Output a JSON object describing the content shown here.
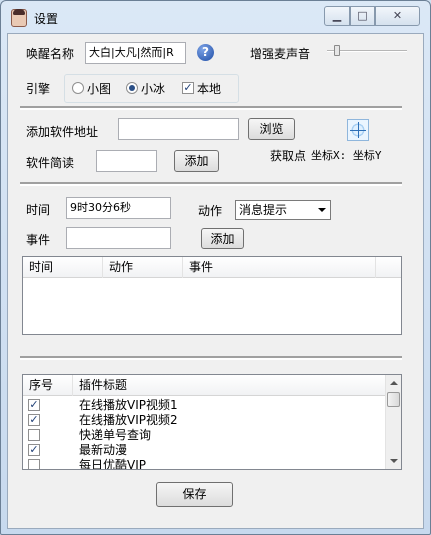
{
  "window": {
    "title": "设置",
    "icons": {
      "app": "avatar-icon",
      "min": "minimize-icon",
      "max": "maximize-icon",
      "close": "close-icon"
    }
  },
  "wake": {
    "label": "唤醒名称",
    "value": "大白|大凡|然而|R",
    "help_icon": "help-icon",
    "volume_label": "增强麦声音",
    "volume_level": 0.1
  },
  "engine": {
    "label": "引擎",
    "options": [
      {
        "label": "小图",
        "checked": false
      },
      {
        "label": "小冰",
        "checked": true
      }
    ],
    "local_label": "本地",
    "local_checked": true
  },
  "software": {
    "add_path_label": "添加软件地址",
    "path_value": "",
    "browse_label": "浏览",
    "read_label": "软件简读",
    "read_value": "",
    "add_label": "添加",
    "pick_icon": "crosshair-icon",
    "pick_label": "获取点",
    "coord_text": "坐标X: 坐标Y"
  },
  "schedule": {
    "time_label": "时间",
    "time_value": "9时30分6秒",
    "action_label": "动作",
    "action_value": "消息提示",
    "event_label": "事件",
    "event_value": "",
    "add_label": "添加",
    "columns": [
      "时间",
      "动作",
      "事件"
    ]
  },
  "plugins": {
    "columns": [
      "序号",
      "插件标题"
    ],
    "rows": [
      {
        "title": "在线播放VIP视频1",
        "checked": true
      },
      {
        "title": "在线播放VIP视频2",
        "checked": true
      },
      {
        "title": "快递单号查询",
        "checked": false
      },
      {
        "title": "最新动漫",
        "checked": true
      },
      {
        "title": "每日优酷VIP",
        "checked": false
      }
    ]
  },
  "footer": {
    "save_label": "保存"
  }
}
